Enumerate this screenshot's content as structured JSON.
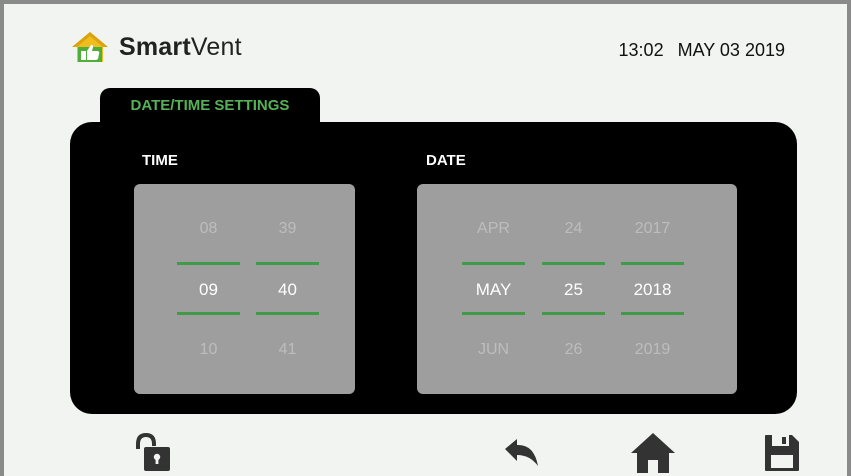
{
  "header": {
    "brand_bold": "Smart",
    "brand_light": "Vent",
    "clock_time": "13:02",
    "clock_date": "MAY 03 2019"
  },
  "tab": {
    "label": "DATE/TIME SETTINGS"
  },
  "time": {
    "label": "TIME",
    "hours": {
      "prev": "08",
      "selected": "09",
      "next": "10"
    },
    "minutes": {
      "prev": "39",
      "selected": "40",
      "next": "41"
    }
  },
  "date": {
    "label": "DATE",
    "month": {
      "prev": "APR",
      "selected": "MAY",
      "next": "JUN"
    },
    "day": {
      "prev": "24",
      "selected": "25",
      "next": "26"
    },
    "year": {
      "prev": "2017",
      "selected": "2018",
      "next": "2019"
    }
  },
  "icons": [
    "house-thumbs-up-icon",
    "unlock-icon",
    "undo-icon",
    "home-icon",
    "save-icon"
  ],
  "colors": {
    "accent_green": "#3f9b48",
    "tab_text": "#55b155",
    "panel": "#000000",
    "picker": "#9e9e9e",
    "background": "#f2f4f1"
  }
}
